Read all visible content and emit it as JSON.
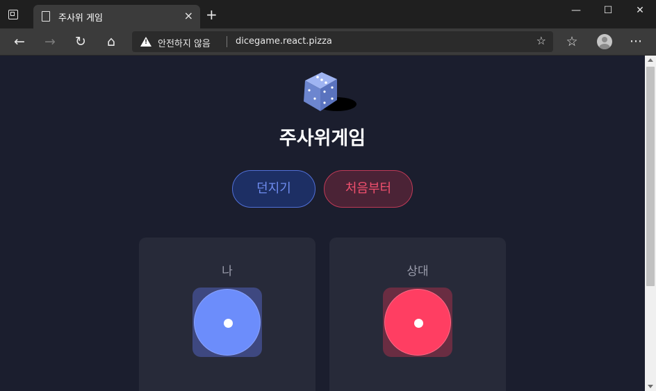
{
  "browser": {
    "tab_title": "주사위 게임",
    "tab_close": "×",
    "new_tab": "+",
    "window_controls": {
      "minimize": "—",
      "maximize": "☐",
      "close": "✕"
    },
    "nav": {
      "back": "←",
      "forward": "→",
      "refresh": "↻",
      "home": "⌂",
      "favorites": "☆",
      "more": "···"
    },
    "security_text": "안전하지 않음",
    "url": "dicegame.react.pizza",
    "add_favorite": "☆"
  },
  "game": {
    "title": "주사위게임",
    "roll_button": "던지기",
    "reset_button": "처음부터",
    "players": [
      {
        "label": "나",
        "die_value": 1,
        "color": "#6c8dfb"
      },
      {
        "label": "상대",
        "die_value": 1,
        "color": "#ff3e62"
      }
    ]
  },
  "colors": {
    "background": "#1b1e2e",
    "card": "#272a39",
    "accent_blue": "#6f8cf0",
    "accent_red": "#f0506e"
  }
}
